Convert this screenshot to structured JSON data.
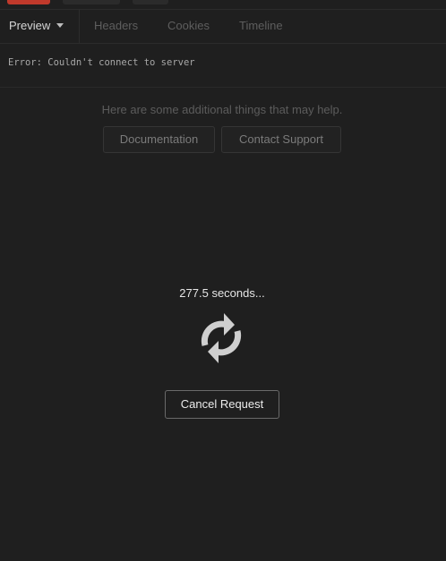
{
  "response_tabs": {
    "preview_label": "Preview",
    "headers_label": "Headers",
    "cookies_label": "Cookies",
    "timeline_label": "Timeline"
  },
  "error": {
    "message": "Error: Couldn't connect to server"
  },
  "help": {
    "text": "Here are some additional things that may help.",
    "documentation_label": "Documentation",
    "support_label": "Contact Support"
  },
  "loading": {
    "elapsed_text": "277.5 seconds...",
    "spinner_icon": "refresh-icon",
    "cancel_label": "Cancel Request"
  },
  "colors": {
    "background": "#1f1f1f",
    "status_pill": "#c0392b",
    "border": "#2c2c2c"
  }
}
